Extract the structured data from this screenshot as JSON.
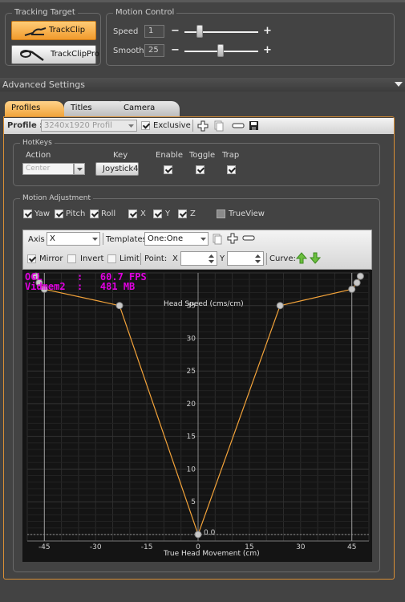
{
  "tracking_target": {
    "legend": "Tracking Target",
    "buttons": [
      {
        "label": "TrackClip",
        "active": true
      },
      {
        "label": "TrackClipPro",
        "active": false
      }
    ]
  },
  "motion_control": {
    "legend": "Motion Control",
    "speed": {
      "label": "Speed",
      "value": "1"
    },
    "smooth": {
      "label": "Smooth",
      "value": "25"
    },
    "minus": "−",
    "plus": "+"
  },
  "advanced": {
    "label": "Advanced Settings"
  },
  "tabs": [
    {
      "label": "Profiles",
      "active": true
    },
    {
      "label": "Titles"
    },
    {
      "label": "Camera"
    }
  ],
  "profile_bar": {
    "label": "Profile :",
    "value": "3240x1920 Profil",
    "exclusive": "Exclusive"
  },
  "hotkeys": {
    "legend": "HotKeys",
    "headers": {
      "action": "Action",
      "key": "Key",
      "enable": "Enable",
      "toggle": "Toggle",
      "trap": "Trap"
    },
    "action_value": "Center",
    "key_value": "Joystick4"
  },
  "motion_adjustment": {
    "legend": "Motion Adjustment",
    "axes": [
      "Yaw",
      "Pitch",
      "Roll",
      "X",
      "Y",
      "Z",
      "TrueView"
    ],
    "toolbar": {
      "axis_label": "Axis",
      "axis_value": "X",
      "templates_label": "Templates",
      "templates_value": "One:One",
      "mirror": "Mirror",
      "invert": "Invert",
      "limit": "Limit",
      "point_label": "Point:",
      "x_label": "X",
      "y_label": "Y",
      "curve_label": "Curve:"
    }
  },
  "overlay": {
    "line1": "OGL      :   60.7 FPS",
    "line2": "Vidmem2  :   481 MB"
  },
  "chart_data": {
    "type": "line",
    "title": "",
    "xlabel": "True Head Movement (cm)",
    "ylabel": "Head Speed (cms/cm)",
    "xlim": [
      -50,
      50
    ],
    "ylim": [
      -1,
      40
    ],
    "xticks": [
      -45,
      -30,
      -15,
      0,
      15,
      30,
      45
    ],
    "yticks": [
      5,
      10,
      15,
      20,
      25,
      30,
      35
    ],
    "baseline_label": "0.0",
    "grid": true,
    "series": [
      {
        "values": [
          [
            -47.5,
            39.5
          ],
          [
            -46.5,
            38.5
          ],
          [
            -45,
            37.5
          ],
          [
            -23,
            35
          ],
          [
            0,
            0
          ],
          [
            24,
            35
          ],
          [
            45,
            37.5
          ],
          [
            46.5,
            38.5
          ],
          [
            47.5,
            39.5
          ]
        ]
      }
    ],
    "line_color": "#f3a33a"
  }
}
